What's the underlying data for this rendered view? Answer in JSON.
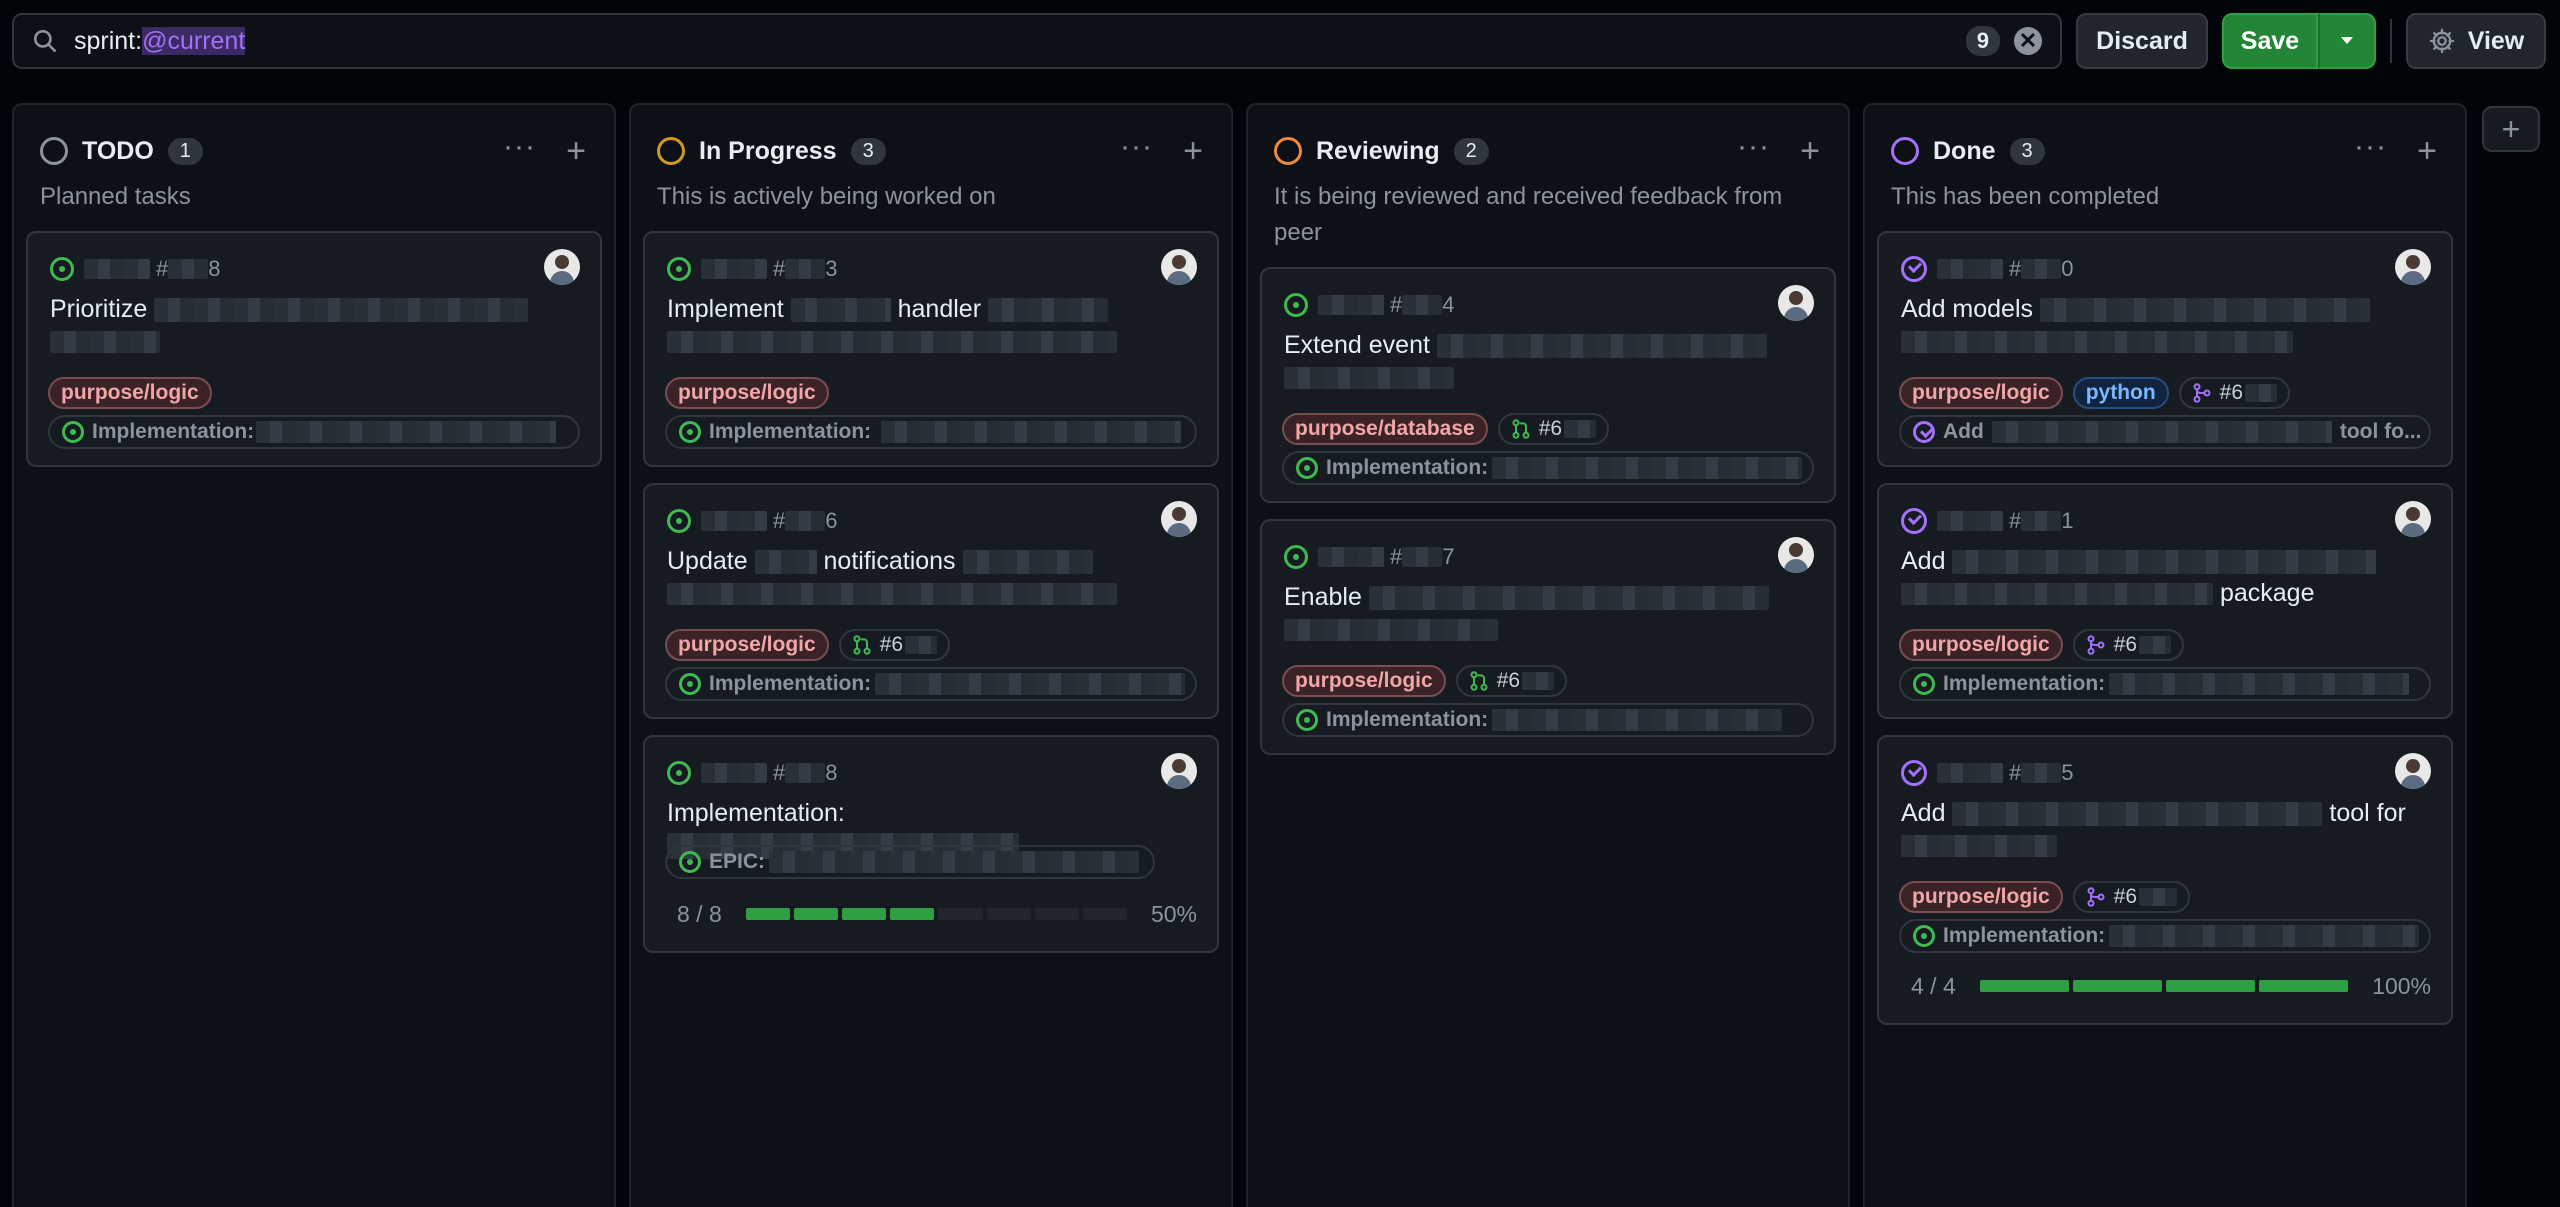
{
  "search": {
    "prefix": "sprint:",
    "highlight": "@current",
    "count": "9",
    "clear": "✕"
  },
  "toolbar": {
    "discard": "Discard",
    "save": "Save",
    "view": "View"
  },
  "colors": {
    "todo": "#8b949e",
    "in_progress": "#d29922",
    "reviewing": "#f0883e",
    "done": "#a371f7",
    "open": "#3fb950"
  },
  "columns": [
    {
      "title": "TODO",
      "count": "1",
      "description": "Planned tasks",
      "cards": [
        {
          "num_prefix": "#",
          "num_suffix": "8",
          "title_a": "Prioritize",
          "label": "purpose/logic",
          "sub": "Implementation:"
        }
      ]
    },
    {
      "title": "In Progress",
      "count": "3",
      "description": "This is actively being worked on",
      "cards": [
        {
          "num_prefix": "#",
          "num_suffix": "3",
          "title_a": "Implement",
          "title_b": "handler",
          "label": "purpose/logic",
          "sub": "Implementation:"
        },
        {
          "num_prefix": "#",
          "num_suffix": "6",
          "title_a": "Update",
          "title_b": "notifications",
          "label": "purpose/logic",
          "pr": "#6",
          "sub": "Implementation:"
        },
        {
          "num_prefix": "#",
          "num_suffix": "8",
          "title_a": "Implementation:",
          "sub": "EPIC:",
          "progress": {
            "text": "8 / 8",
            "percent": "50%",
            "filled": 4,
            "total": 8
          }
        }
      ]
    },
    {
      "title": "Reviewing",
      "count": "2",
      "description": "It is being reviewed and received feedback from peer",
      "cards": [
        {
          "num_prefix": "#",
          "num_suffix": "4",
          "title_a": "Extend event",
          "label": "purpose/database",
          "pr": "#6",
          "sub": "Implementation:"
        },
        {
          "num_prefix": "#",
          "num_suffix": "7",
          "title_a": "Enable",
          "label": "purpose/logic",
          "pr": "#6",
          "sub": "Implementation:"
        }
      ]
    },
    {
      "title": "Done",
      "count": "3",
      "description": "This has been completed",
      "cards": [
        {
          "num_prefix": "#",
          "num_suffix": "0",
          "title_a": "Add models",
          "label": "purpose/logic",
          "label2": "python",
          "branch": "#6",
          "sub": "Add",
          "sub_end": "tool fo..."
        },
        {
          "num_prefix": "#",
          "num_suffix": "1",
          "title_a": "Add",
          "title_b": "package",
          "label": "purpose/logic",
          "branch": "#6",
          "sub": "Implementation:"
        },
        {
          "num_prefix": "#",
          "num_suffix": "5",
          "title_a": "Add",
          "title_b": "tool for",
          "label": "purpose/logic",
          "branch": "#6",
          "sub": "Implementation:",
          "progress": {
            "text": "4 / 4",
            "percent": "100%",
            "filled": 4,
            "total": 4
          }
        }
      ]
    }
  ],
  "add_column": "+"
}
